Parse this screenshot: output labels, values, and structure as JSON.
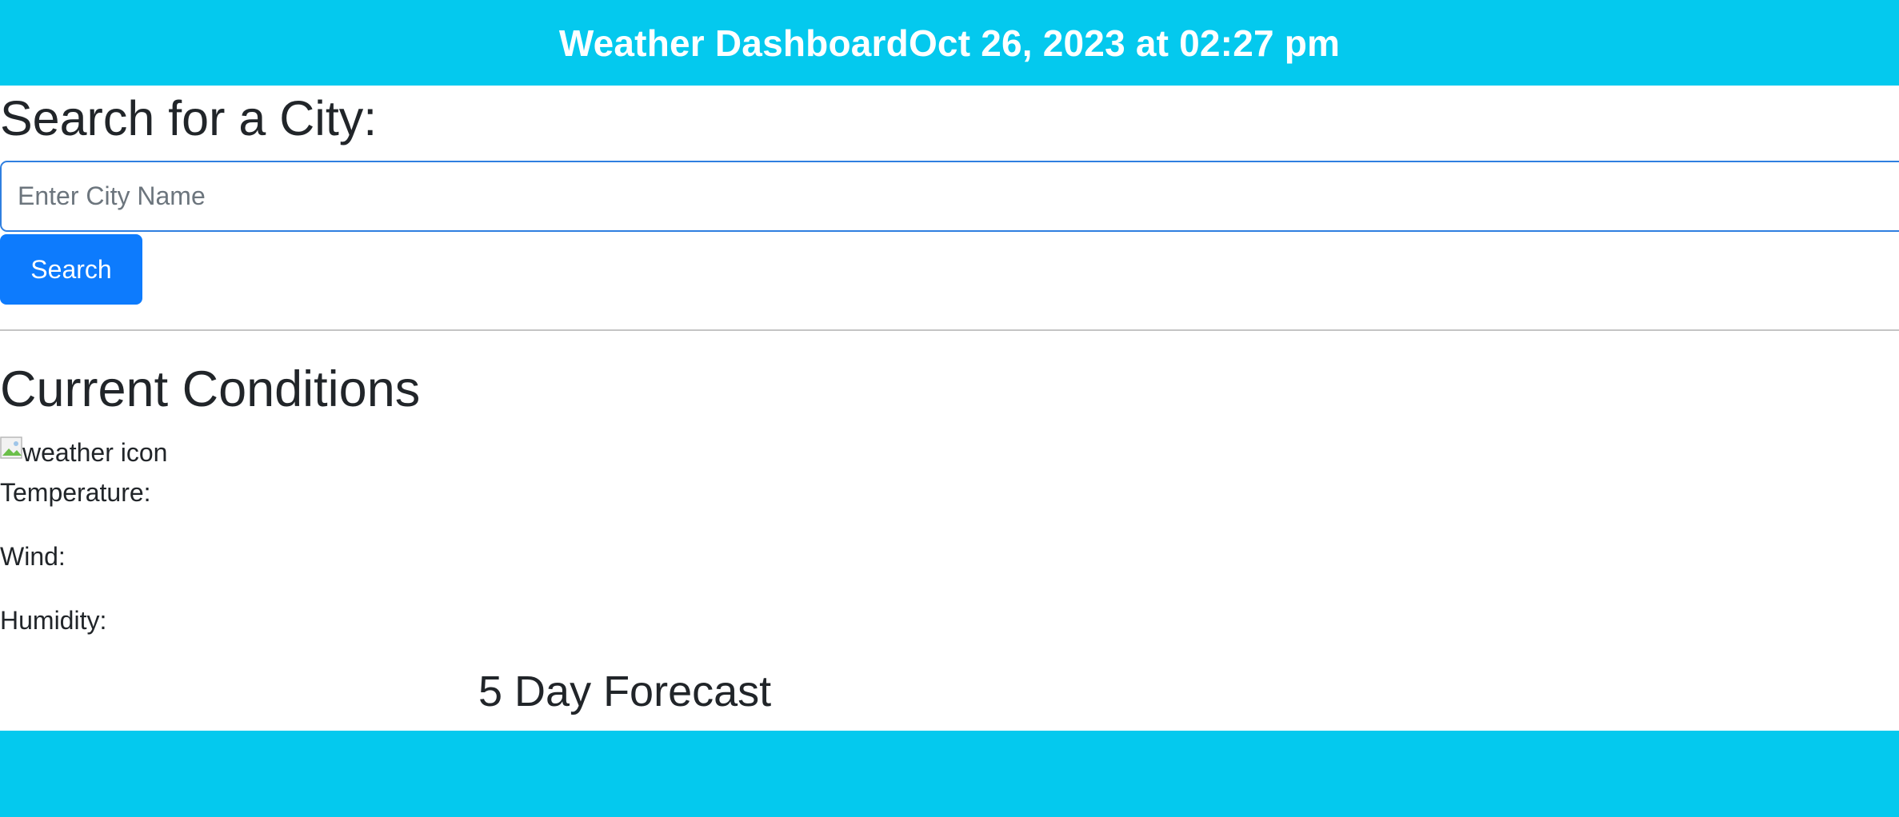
{
  "header": {
    "title": "Weather Dashboard",
    "datetime": "Oct 26, 2023 at 02:27 pm"
  },
  "search": {
    "heading": "Search for a City:",
    "placeholder": "Enter City Name",
    "value": "",
    "button_label": "Search"
  },
  "current": {
    "heading": "Current Conditions",
    "icon_alt": "weather icon",
    "temperature_label": "Temperature:",
    "wind_label": "Wind:",
    "humidity_label": "Humidity:"
  },
  "forecast": {
    "heading": "5 Day Forecast"
  },
  "colors": {
    "banner": "#04c9ee",
    "primary_button": "#0d7bfd",
    "input_border": "#2f7fe0"
  }
}
